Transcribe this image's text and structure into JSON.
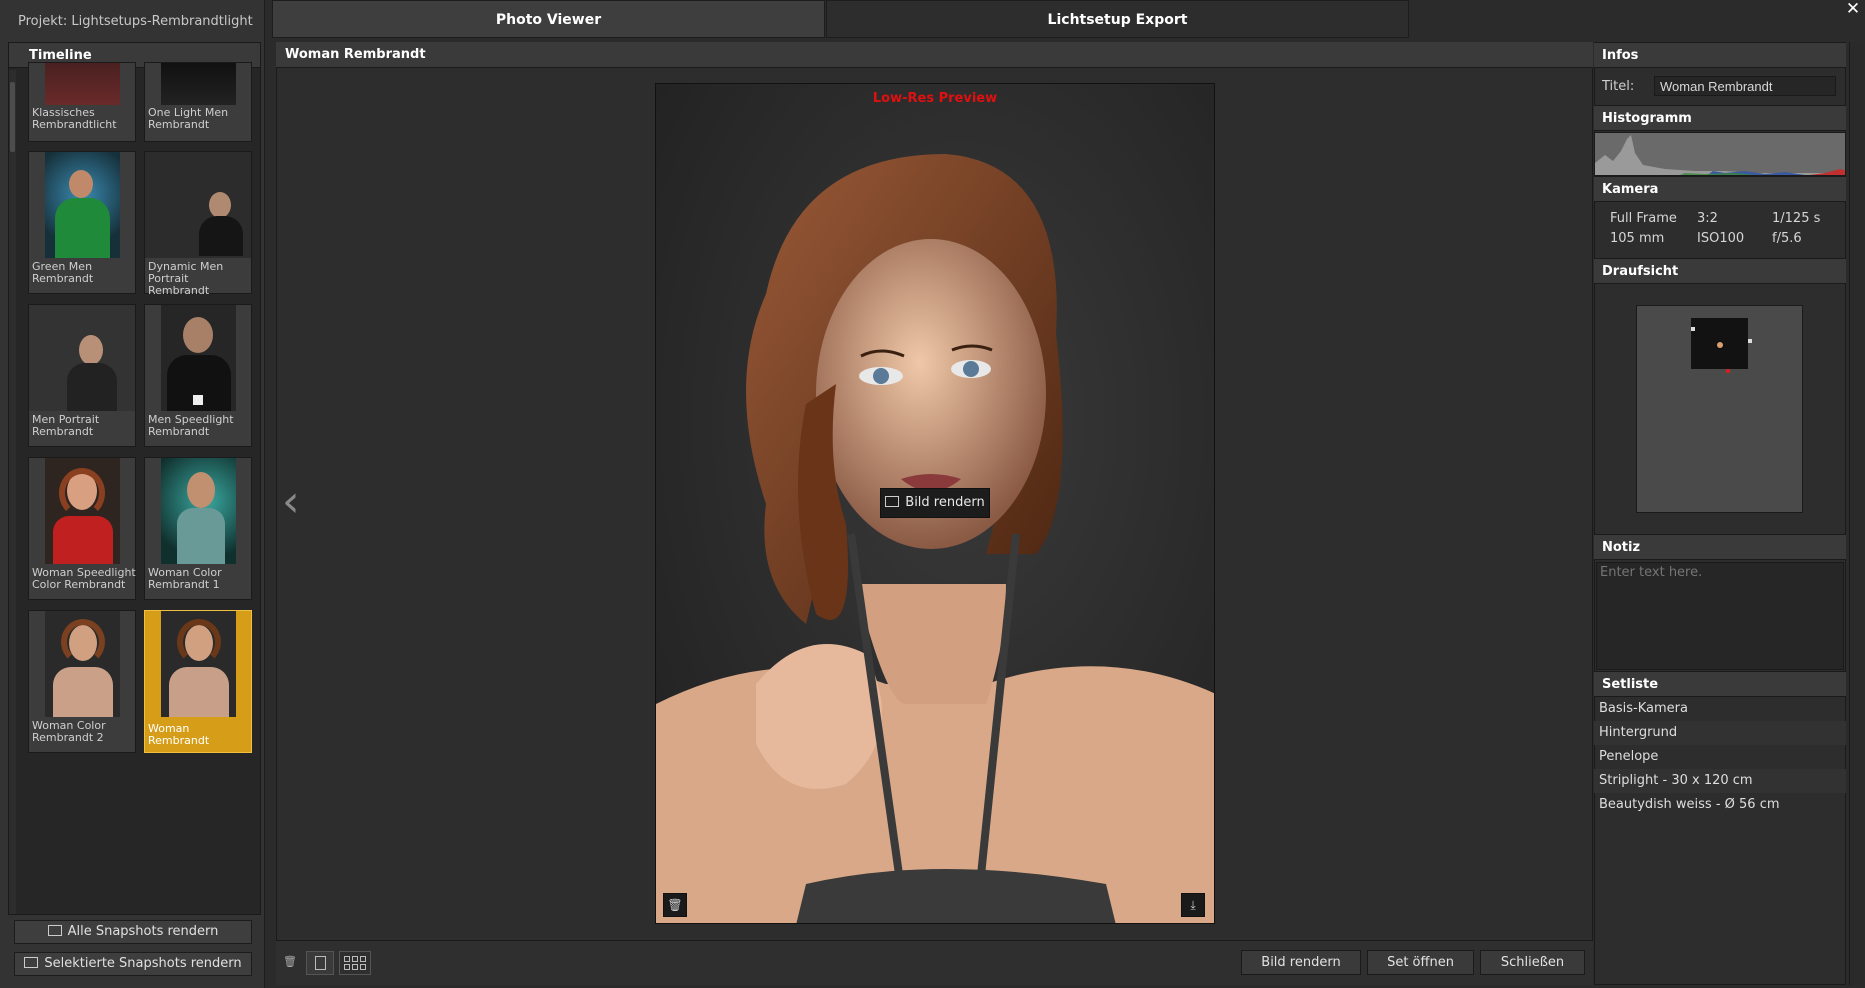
{
  "project": {
    "title": "Projekt: Lightsetups-Rembrandtlight"
  },
  "tabs": [
    {
      "label": "Photo Viewer",
      "active": true
    },
    {
      "label": "Lichtsetup Export",
      "active": false
    }
  ],
  "timeline": {
    "title": "Timeline",
    "items": [
      {
        "label": "Klassisches Rembrandtlicht",
        "selected": false
      },
      {
        "label": "One Light Men Rembrandt",
        "selected": false
      },
      {
        "label": "Green Men Rembrandt",
        "selected": false
      },
      {
        "label": "Dynamic Men Portrait Rembrandt",
        "selected": false
      },
      {
        "label": "Men Portrait Rembrandt",
        "selected": false
      },
      {
        "label": "Men Speedlight Rembrandt",
        "selected": false
      },
      {
        "label": "Woman Speedlight Color Rembrandt",
        "selected": false
      },
      {
        "label": "Woman Color Rembrandt 1",
        "selected": false
      },
      {
        "label": "Woman Color Rembrandt 2",
        "selected": false
      },
      {
        "label": "Woman Rembrandt",
        "selected": true
      }
    ],
    "render_all": "Alle Snapshots rendern",
    "render_selected": "Selektierte Snapshots rendern"
  },
  "viewer": {
    "title": "Woman Rembrandt",
    "preview_label": "Low-Res Preview",
    "render_overlay": "Bild rendern",
    "buttons": {
      "render": "Bild rendern",
      "open_set": "Set öffnen",
      "close": "Schließen"
    }
  },
  "infos": {
    "header": "Infos",
    "title_label": "Titel:",
    "title_value": "Woman Rembrandt"
  },
  "histogram": {
    "header": "Histogramm"
  },
  "camera": {
    "header": "Kamera",
    "format": "Full Frame",
    "ratio": "3:2",
    "shutter": "1/125 s",
    "focal": "105 mm",
    "iso": "ISO100",
    "aperture": "f/5.6"
  },
  "topview": {
    "header": "Draufsicht"
  },
  "note": {
    "header": "Notiz",
    "placeholder": "Enter text here."
  },
  "setlist": {
    "header": "Setliste",
    "items": [
      "Basis-Kamera",
      "Hintergrund",
      "Penelope",
      "Striplight - 30 x 120 cm",
      "Beautydish weiss - Ø 56 cm"
    ]
  },
  "colors": {
    "accent": "#d69e18",
    "preview_red": "#e01010",
    "panel": "#2d2d2d"
  }
}
